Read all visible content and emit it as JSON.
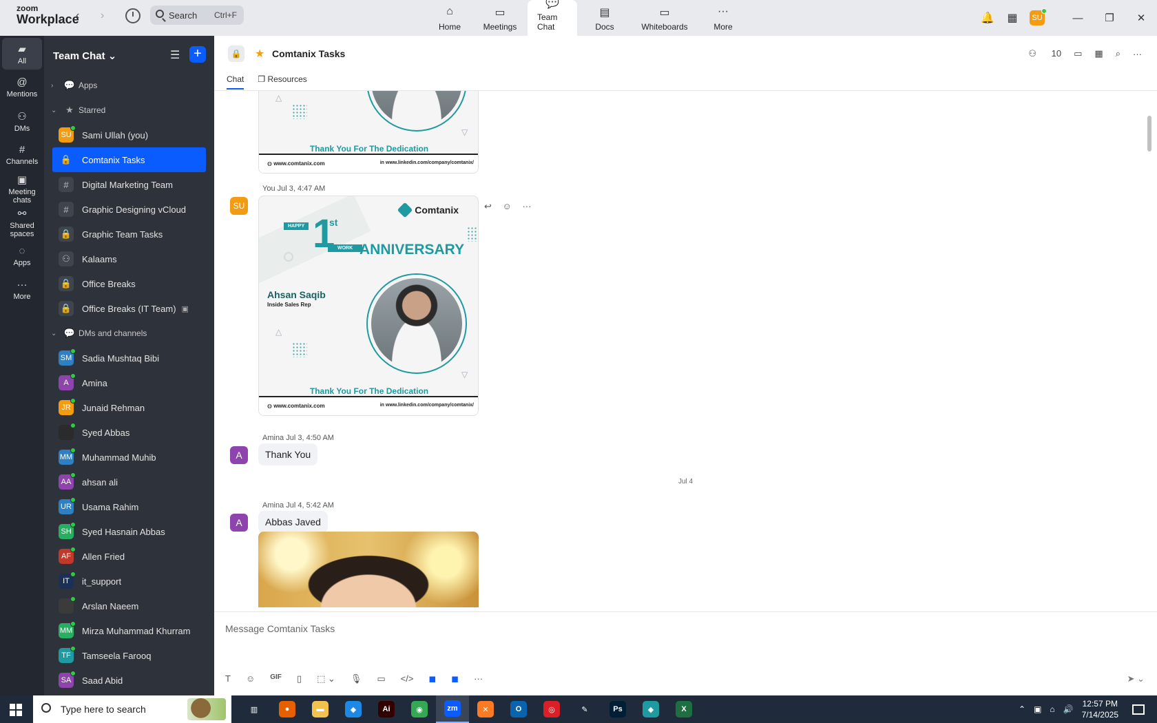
{
  "app": {
    "brand_top": "zoom",
    "brand_bottom": "Workplace",
    "search_label": "Search",
    "search_shortcut": "Ctrl+F"
  },
  "top_tabs": [
    {
      "label": "Home",
      "icon": "⌂"
    },
    {
      "label": "Meetings",
      "icon": "▭"
    },
    {
      "label": "Team Chat",
      "icon": "💬"
    },
    {
      "label": "Docs",
      "icon": "▤"
    },
    {
      "label": "Whiteboards",
      "icon": "▭"
    },
    {
      "label": "More",
      "icon": "···"
    }
  ],
  "user_initials": "SU",
  "rail": [
    {
      "label": "All",
      "icon": "▰"
    },
    {
      "label": "Mentions",
      "icon": "@"
    },
    {
      "label": "DMs",
      "icon": "⚇"
    },
    {
      "label": "Channels",
      "icon": "#"
    },
    {
      "label": "Meeting chats",
      "icon": "▣"
    },
    {
      "label": "Shared spaces",
      "icon": "⚯"
    },
    {
      "label": "Apps",
      "icon": "◌"
    },
    {
      "label": "More",
      "icon": "···"
    }
  ],
  "sidebar": {
    "title": "Team Chat",
    "sections": {
      "apps": "Apps",
      "starred": "Starred",
      "dms": "DMs and channels"
    },
    "starred": [
      {
        "name": "Sami Ullah (you)",
        "initials": "SU",
        "color": "#f39c12",
        "type": "user"
      },
      {
        "name": "Comtanix Tasks",
        "initials": "🔒",
        "color": "",
        "type": "channel-lock",
        "selected": true
      },
      {
        "name": "Digital Marketing Team",
        "initials": "#",
        "color": "",
        "type": "channel"
      },
      {
        "name": "Graphic Designing vCloud",
        "initials": "#",
        "color": "",
        "type": "channel"
      },
      {
        "name": "Graphic Team Tasks",
        "initials": "🔒",
        "color": "",
        "type": "channel"
      },
      {
        "name": "Kalaams",
        "initials": "⚇",
        "color": "",
        "type": "channel"
      },
      {
        "name": "Office Breaks",
        "initials": "🔒",
        "color": "",
        "type": "channel"
      },
      {
        "name": "Office Breaks (IT Team)",
        "initials": "🔒",
        "color": "",
        "type": "channel"
      }
    ],
    "dms": [
      {
        "name": "Sadia Mushtaq Bibi",
        "initials": "SM",
        "color": "#2f80c3"
      },
      {
        "name": "Amina",
        "initials": "A",
        "color": "#8e44ad"
      },
      {
        "name": "Junaid Rehman",
        "initials": "JR",
        "color": "#f39c12"
      },
      {
        "name": "Syed Abbas",
        "initials": "",
        "color": "#2b2b2b"
      },
      {
        "name": "Muhammad Muhib",
        "initials": "MM",
        "color": "#2f80c3"
      },
      {
        "name": "ahsan ali",
        "initials": "AA",
        "color": "#8e44ad"
      },
      {
        "name": "Usama Rahim",
        "initials": "UR",
        "color": "#2f80c3"
      },
      {
        "name": "Syed Hasnain Abbas",
        "initials": "SH",
        "color": "#27ae60"
      },
      {
        "name": "Allen Fried",
        "initials": "AF",
        "color": "#c0392b"
      },
      {
        "name": "it_support",
        "initials": "IT",
        "color": "#1c2f55"
      },
      {
        "name": "Arslan Naeem",
        "initials": "",
        "color": "#3b3b3b"
      },
      {
        "name": "Mirza Muhammad Khurram",
        "initials": "MM",
        "color": "#27ae60"
      },
      {
        "name": "Tamseela Farooq",
        "initials": "TF",
        "color": "#1e9aa0"
      },
      {
        "name": "Saad Abid",
        "initials": "SA",
        "color": "#8e44ad"
      }
    ]
  },
  "channel": {
    "title": "Comtanix Tasks",
    "tabs": [
      "Chat",
      "Resources"
    ],
    "member_count": "10"
  },
  "messages": {
    "msg1_meta": "You Jul 3, 4:47 AM",
    "msg1_initials": "SU",
    "card": {
      "brand": "Comtanix",
      "happy": "HAPPY",
      "number": "1",
      "ordinal": "st",
      "work": "WORK",
      "anniversary": "ANNIVERSARY",
      "person": "Ahsan Saqib",
      "role": "Inside Sales Rep",
      "thanks": "Thank You For The Dedication",
      "website": "www.comtanix.com",
      "linkedin": "www.linkedin.com/company/comtanix/"
    },
    "msg2_meta": "Amina Jul 3, 4:50 AM",
    "msg2_initials": "A",
    "msg2_text": "Thank You",
    "day_divider": "Jul 4",
    "msg3_meta": "Amina Jul 4, 5:42 AM",
    "msg3_initials": "A",
    "msg3_text": "Abbas Javed"
  },
  "composer": {
    "placeholder": "Message Comtanix Tasks",
    "gif_label": "GIF"
  },
  "taskbar": {
    "search_placeholder": "Type here to search",
    "time": "12:57 PM",
    "date": "7/14/2025",
    "apps": [
      {
        "name": "task-view",
        "glyph": "▥",
        "color": "transparent"
      },
      {
        "name": "firefox",
        "glyph": "●",
        "color": "#e66000"
      },
      {
        "name": "file-explorer",
        "glyph": "▬",
        "color": "#f2c14e"
      },
      {
        "name": "vscode",
        "glyph": "◆",
        "color": "#1e88e5"
      },
      {
        "name": "illustrator",
        "glyph": "Ai",
        "color": "#330000"
      },
      {
        "name": "chrome",
        "glyph": "◉",
        "color": "#34a853"
      },
      {
        "name": "zoom",
        "glyph": "zm",
        "color": "#0b5cff"
      },
      {
        "name": "xampp",
        "glyph": "✕",
        "color": "#fb7a24"
      },
      {
        "name": "outlook",
        "glyph": "O",
        "color": "#0a64ad"
      },
      {
        "name": "creative-cloud",
        "glyph": "◎",
        "color": "#da1f26"
      },
      {
        "name": "pen-tool",
        "glyph": "✎",
        "color": "transparent"
      },
      {
        "name": "photoshop",
        "glyph": "Ps",
        "color": "#001e36"
      },
      {
        "name": "gem-app",
        "glyph": "◆",
        "color": "#1e9aa0"
      },
      {
        "name": "excel",
        "glyph": "X",
        "color": "#1d6f42"
      }
    ]
  }
}
